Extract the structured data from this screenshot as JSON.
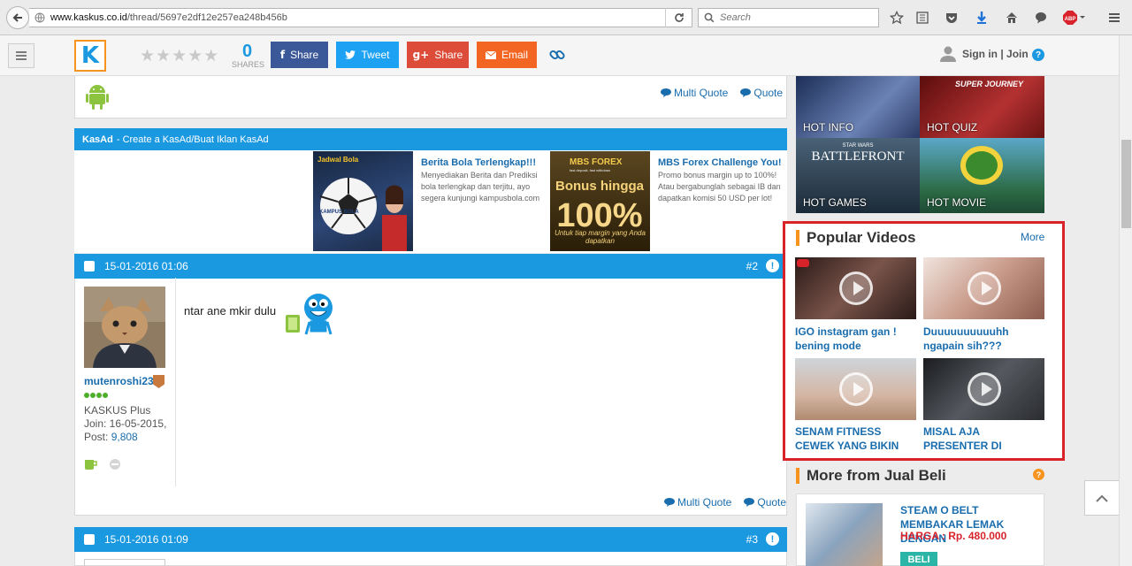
{
  "browser": {
    "url_host": "www.kaskus.co.id",
    "url_path": "/thread/5697e2df12e257ea248b456b",
    "search_placeholder": "Search",
    "abp": "ABP"
  },
  "nav": {
    "share_count": "0",
    "share_count_label": "SHARES",
    "facebook_label": "Share",
    "twitter_label": "Tweet",
    "gplus_label": "Share",
    "email_label": "Email",
    "signin_label": "Sign in | Join",
    "logo": "K"
  },
  "post1": {
    "multi_quote": "Multi Quote",
    "quote": "Quote"
  },
  "kasad": {
    "brand": "KasAd",
    "text": "- Create a KasAd/Buat Iklan KasAd",
    "ads": [
      {
        "title": "Berita Bola Terlengkap!!!",
        "desc": "Menyediakan Berita dan Prediksi bola terlengkap dan terjitu, ayo segera kunjungi kampusbola.com",
        "img_top": "Jadwal Bola",
        "img_mid": "KAMPUS BOLA"
      },
      {
        "title": "MBS Forex Challenge You!",
        "desc": "Promo bonus margin up to 100%! Atau bergabunglah sebagai IB dan dapatkan komisi 50 USD per lot!",
        "img_top": "MBS FOREX",
        "img_sub": "fast deposit, fast withdraw",
        "img_big": "Bonus hingga",
        "img_pct": "100%",
        "img_bottom": "Untuk tiap margin yang Anda dapatkan"
      }
    ]
  },
  "post2": {
    "date": "15-01-2016 01:06",
    "number": "#2",
    "warn": "!",
    "username": "mutenroshi23",
    "role": "KASKUS Plus",
    "join": "Join: 16-05-2015,",
    "post_label": "Post: ",
    "post_count": "9,808",
    "content": "ntar ane mkir dulu",
    "multi_quote": "Multi Quote",
    "quote": "Quote"
  },
  "post3": {
    "date": "15-01-2016 01:09",
    "number": "#3",
    "warn": "!"
  },
  "hot": [
    {
      "label": "HOT INFO",
      "color": "#3c5a8c"
    },
    {
      "label": "HOT QUIZ",
      "color": "#8a1c1c",
      "caption": "SUPER JOURNEY"
    },
    {
      "label": "HOT GAMES",
      "color": "#2b4258",
      "caption": "BATTLEFRONT",
      "small": "STAR WARS"
    },
    {
      "label": "HOT MOVIE",
      "color": "#3f7a96"
    }
  ],
  "popular_videos": {
    "title": "Popular Videos",
    "more": "More",
    "items": [
      {
        "caption": "IGO instagram gan ! bening mode",
        "color": "#6b4a44"
      },
      {
        "caption": "Duuuuuuuuuuhh ngapain sih???",
        "color": "#c99b8a"
      },
      {
        "caption": "SENAM FITNESS CEWEK YANG BIKIN SEHAT MATA",
        "color": "#d4b6a4"
      },
      {
        "caption": "MISAL AJA PRESENTER DI INDONESIA KAYAK",
        "color": "#3a3c40"
      }
    ]
  },
  "more_from": {
    "title": "More from Jual Beli",
    "item_title": "STEAM O BELT MEMBAKAR LEMAK DENGAN",
    "item_price": "HARGA : Rp. 480.000",
    "item_button": "BELI"
  }
}
